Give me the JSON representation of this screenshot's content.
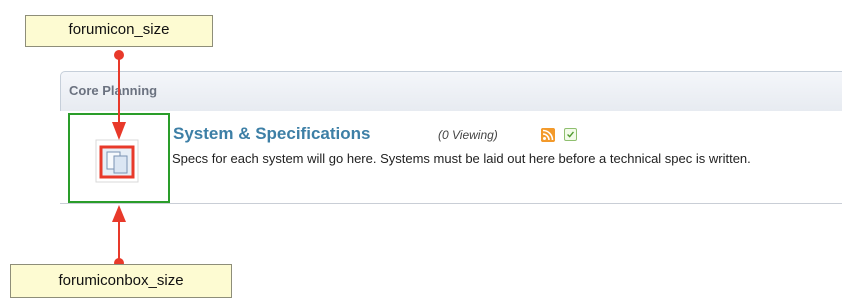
{
  "callouts": {
    "top_label": "forumicon_size",
    "bottom_label": "forumiconbox_size"
  },
  "section": {
    "title": "Core Planning"
  },
  "forum": {
    "title": "System & Specifications",
    "viewing": "(0 Viewing)",
    "description": "Specs for each system will go here. Systems must be laid out here before a technical spec is written."
  },
  "colors": {
    "callout_bg": "#fdfbd2",
    "annotation_red": "#e8392a",
    "iconbox_green": "#2a9d2a",
    "forum_title_blue": "#3d7fa6"
  },
  "icons": [
    "forum-icon",
    "rss-icon",
    "subscribe-check-icon"
  ]
}
